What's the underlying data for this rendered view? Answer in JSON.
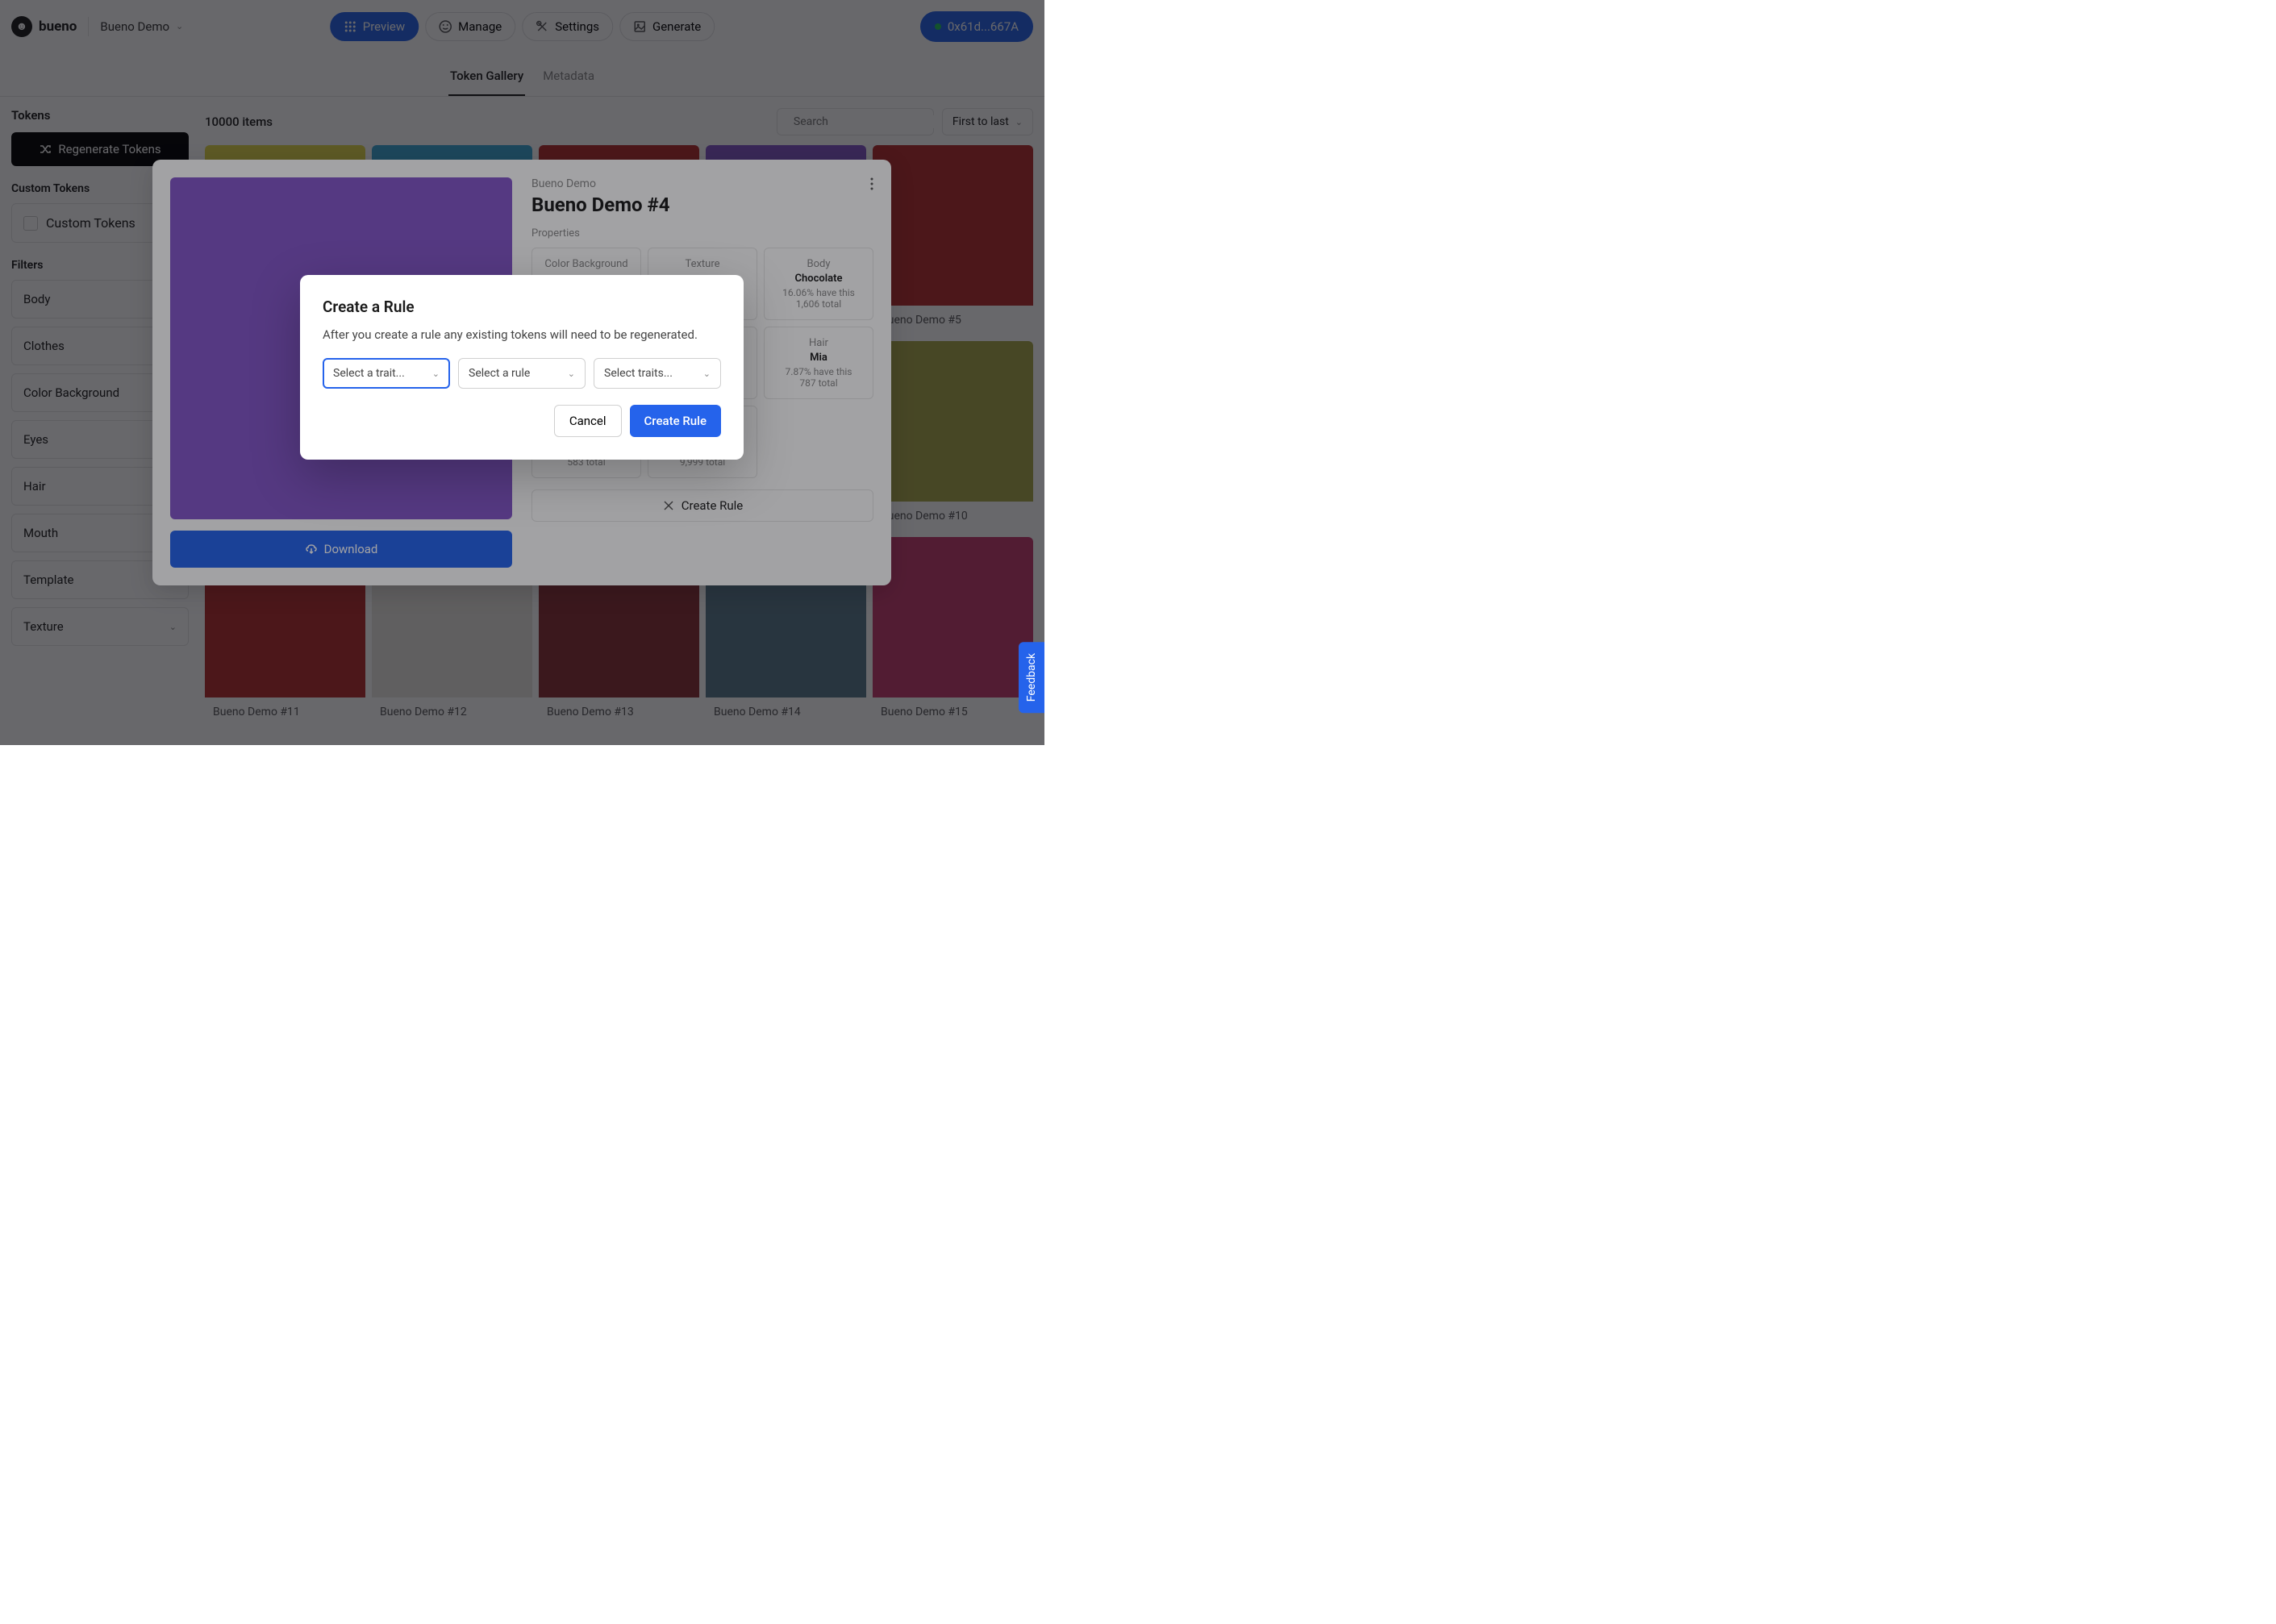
{
  "header": {
    "brand": "bueno",
    "project": "Bueno Demo",
    "buttons": {
      "preview": "Preview",
      "manage": "Manage",
      "settings": "Settings",
      "generate": "Generate"
    },
    "wallet": "0x61d...667A"
  },
  "tabs": {
    "gallery": "Token Gallery",
    "metadata": "Metadata"
  },
  "sidebar": {
    "tokens_title": "Tokens",
    "regenerate": "Regenerate Tokens",
    "custom_tokens_title": "Custom Tokens",
    "custom_tokens_checkbox": "Custom Tokens",
    "filters_title": "Filters",
    "filters": [
      "Body",
      "Clothes",
      "Color Background",
      "Eyes",
      "Hair",
      "Mouth",
      "Template",
      "Texture"
    ]
  },
  "content": {
    "count": "10000 items",
    "search_placeholder": "Search",
    "sort": "First to last",
    "tokens": [
      {
        "label": "",
        "bg": "bg-yellow"
      },
      {
        "label": "",
        "bg": "bg-blue"
      },
      {
        "label": "",
        "bg": "bg-red"
      },
      {
        "label": "",
        "bg": "bg-purple"
      },
      {
        "label": "Bueno Demo #5",
        "bg": "bg-red"
      },
      {
        "label": "",
        "bg": "bg-purple"
      },
      {
        "label": "",
        "bg": "bg-blue"
      },
      {
        "label": "",
        "bg": "bg-red"
      },
      {
        "label": "",
        "bg": "bg-red"
      },
      {
        "label": "Bueno Demo #10",
        "bg": "bg-olive"
      },
      {
        "label": "Bueno Demo #11",
        "bg": "bg-red"
      },
      {
        "label": "Bueno Demo #12",
        "bg": "bg-white"
      },
      {
        "label": "Bueno Demo #13",
        "bg": "bg-maroon"
      },
      {
        "label": "Bueno Demo #14",
        "bg": "bg-slate"
      },
      {
        "label": "Bueno Demo #15",
        "bg": "bg-pink"
      }
    ]
  },
  "panel": {
    "collection": "Bueno Demo",
    "title": "Bueno Demo #4",
    "download": "Download",
    "properties_label": "Properties",
    "properties": [
      {
        "name": "Color Background",
        "value": "",
        "stats1": "",
        "stats2": ""
      },
      {
        "name": "Texture",
        "value": "",
        "stats1": "",
        "stats2": ""
      },
      {
        "name": "Body",
        "value": "Chocolate",
        "stats1": "16.06% have this",
        "stats2": "1,606 total"
      },
      {
        "name": "",
        "value": "",
        "stats1": "",
        "stats2": ""
      },
      {
        "name": "",
        "value": "",
        "stats1": "",
        "stats2": ""
      },
      {
        "name": "Hair",
        "value": "Mia",
        "stats1": "7.87% have this",
        "stats2": "787 total"
      },
      {
        "name": "",
        "value": "",
        "stats1": "",
        "stats2": "583 total"
      },
      {
        "name": "",
        "value": "",
        "stats1": "",
        "stats2": "9,999 total"
      }
    ],
    "create_rule": "Create Rule"
  },
  "modal": {
    "title": "Create a Rule",
    "desc": "After you create a rule any existing tokens will need to be regenerated.",
    "select_trait": "Select a trait...",
    "select_rule": "Select a rule",
    "select_traits": "Select traits...",
    "cancel": "Cancel",
    "create": "Create Rule"
  },
  "feedback": "Feedback"
}
